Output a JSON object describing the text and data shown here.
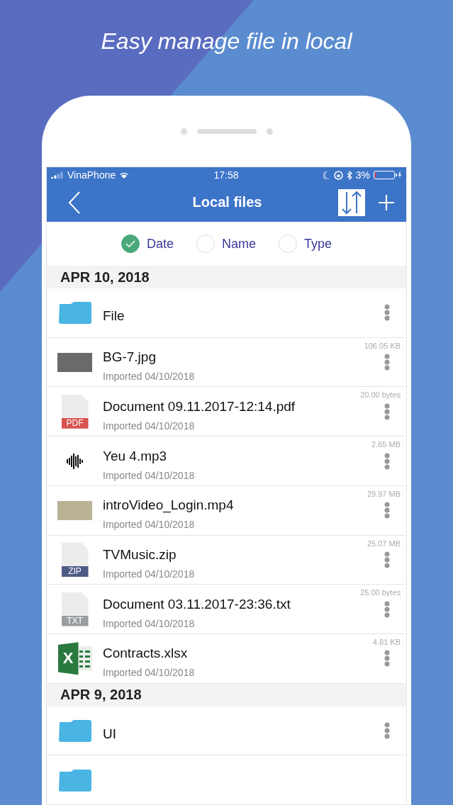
{
  "headline": "Easy manage file in local",
  "status_bar": {
    "carrier": "VinaPhone",
    "time": "17:58",
    "battery": "3%"
  },
  "nav_bar": {
    "title": "Local files"
  },
  "sort_options": [
    {
      "label": "Date",
      "selected": true
    },
    {
      "label": "Name",
      "selected": false
    },
    {
      "label": "Type",
      "selected": false
    }
  ],
  "sections": [
    {
      "date": "APR 10, 2018",
      "items": [
        {
          "kind": "folder",
          "name": "File"
        },
        {
          "kind": "image",
          "name": "BG-7.jpg",
          "size": "106.05 KB",
          "subtitle": "Imported 04/10/2018"
        },
        {
          "kind": "pdf",
          "badge": "PDF",
          "name": "Document 09.11.2017-12:14.pdf",
          "size": "20.00 bytes",
          "subtitle": "Imported 04/10/2018"
        },
        {
          "kind": "audio",
          "name": "Yeu 4.mp3",
          "size": "2.65 MB",
          "subtitle": "Imported 04/10/2018"
        },
        {
          "kind": "video",
          "name": "introVideo_Login.mp4",
          "size": "29.97 MB",
          "subtitle": "Imported 04/10/2018"
        },
        {
          "kind": "zip",
          "badge": "ZIP",
          "name": "TVMusic.zip",
          "size": "25.07 MB",
          "subtitle": "Imported 04/10/2018"
        },
        {
          "kind": "txt",
          "badge": "TXT",
          "name": "Document 03.11.2017-23:36.txt",
          "size": "25.00 bytes",
          "subtitle": "Imported 04/10/2018"
        },
        {
          "kind": "xlsx",
          "badge": "X",
          "name": "Contracts.xlsx",
          "size": "4.81 KB",
          "subtitle": "Imported 04/10/2018"
        }
      ]
    },
    {
      "date": "APR 9, 2018",
      "items": [
        {
          "kind": "folder",
          "name": "UI"
        },
        {
          "kind": "folder"
        }
      ]
    }
  ]
}
